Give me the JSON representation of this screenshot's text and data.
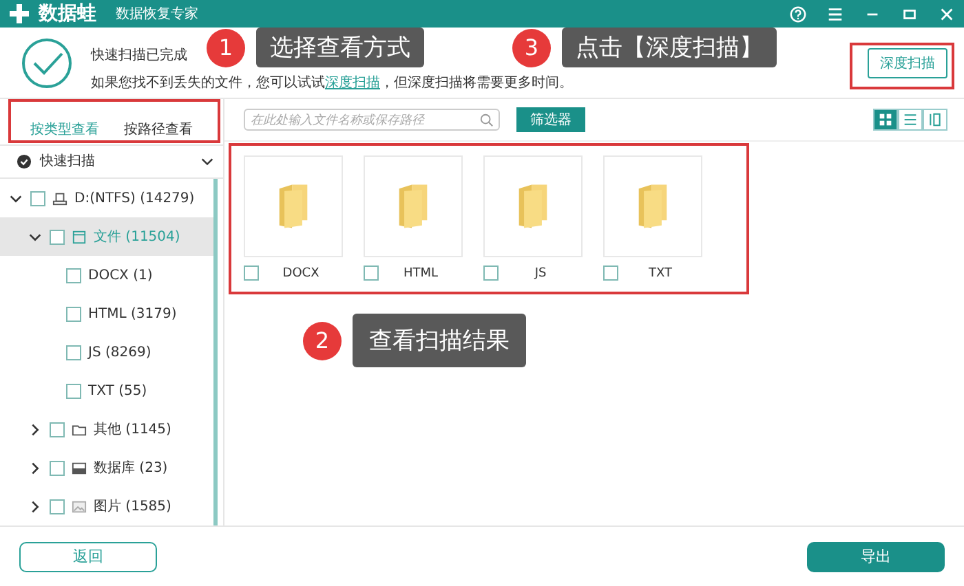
{
  "window": {
    "app_name": "数据蛙",
    "subtitle": "数据恢复专家"
  },
  "scan_status": {
    "line1": "快速扫描已完成",
    "line2_before": "如果您找不到丢失的文件，您可以试试",
    "link": "深度扫描",
    "line2_after": "，但深度扫描将需要更多时间。"
  },
  "deep_scan_button": "深度扫描",
  "view_tabs": [
    {
      "label": "按类型查看",
      "selected": true
    },
    {
      "label": "按路径查看",
      "selected": false
    }
  ],
  "scan_mode": {
    "label": "快速扫描"
  },
  "tree": [
    {
      "label": "D:(NTFS) (14279)",
      "kind": "drive",
      "expanded": true,
      "selected": false,
      "checked": false,
      "children": [
        {
          "label": "文件 (11504)",
          "kind": "document",
          "expanded": true,
          "selected": true,
          "checked": false,
          "children": [
            {
              "label": "DOCX (1)",
              "kind": "leaf",
              "selected": false,
              "checked": false
            },
            {
              "label": "HTML (3179)",
              "kind": "leaf",
              "selected": false,
              "checked": false
            },
            {
              "label": "JS (8269)",
              "kind": "leaf",
              "selected": false,
              "checked": false
            },
            {
              "label": "TXT (55)",
              "kind": "leaf",
              "selected": false,
              "checked": false
            }
          ]
        },
        {
          "label": "其他 (1145)",
          "kind": "folder",
          "expanded": false,
          "selected": false,
          "checked": false
        },
        {
          "label": "数据库 (23)",
          "kind": "database",
          "expanded": false,
          "selected": false,
          "checked": false
        },
        {
          "label": "图片 (1585)",
          "kind": "image",
          "expanded": false,
          "selected": false,
          "checked": false
        }
      ]
    }
  ],
  "search": {
    "placeholder": "在此处输入文件名称或保存路径"
  },
  "filter_button": "筛选器",
  "view_modes": [
    {
      "kind": "grid",
      "selected": true
    },
    {
      "kind": "list",
      "selected": false
    },
    {
      "kind": "detail",
      "selected": false
    }
  ],
  "files": [
    {
      "name": "DOCX",
      "checked": false
    },
    {
      "name": "HTML",
      "checked": false
    },
    {
      "name": "JS",
      "checked": false
    },
    {
      "name": "TXT",
      "checked": false
    }
  ],
  "callouts": [
    {
      "number": "1",
      "text": "选择查看方式"
    },
    {
      "number": "2",
      "text": "查看扫描结果"
    },
    {
      "number": "3",
      "text": "点击【深度扫描】"
    }
  ],
  "buttons": {
    "back": "返回",
    "export": "导出"
  }
}
